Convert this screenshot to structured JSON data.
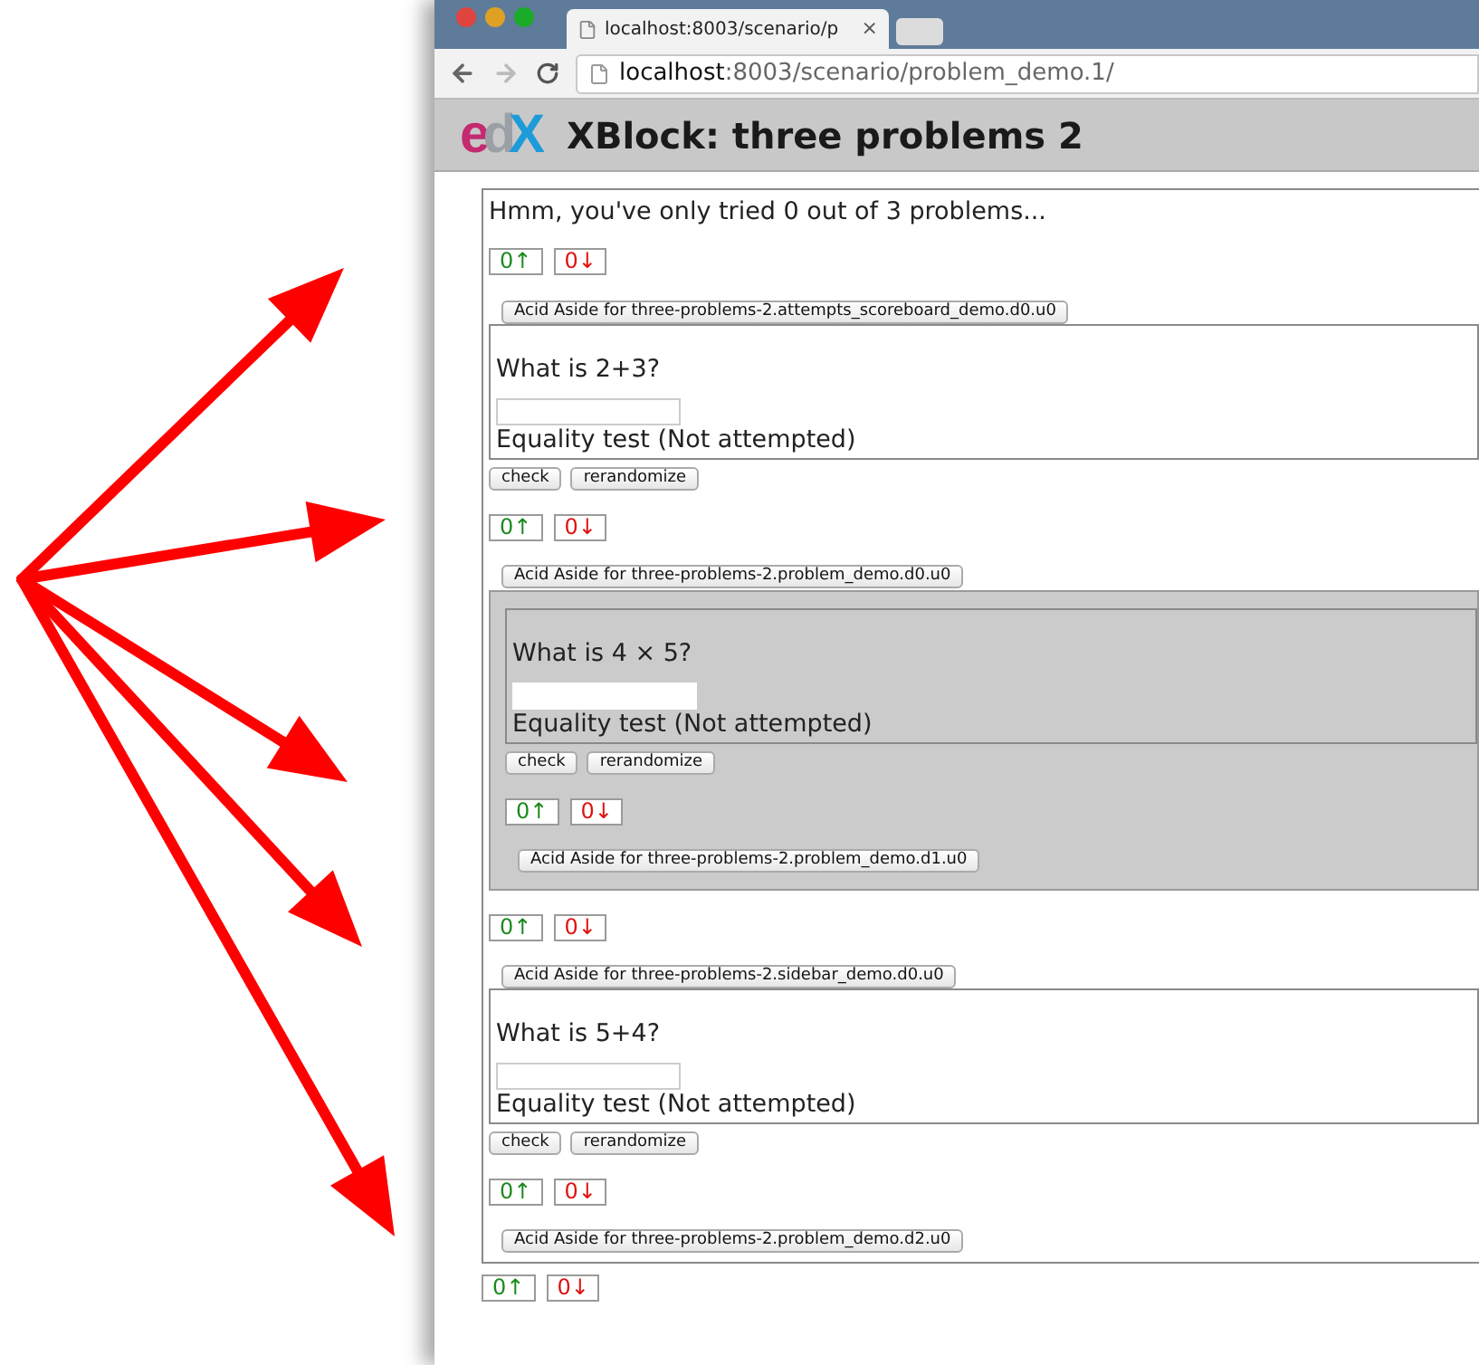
{
  "browser": {
    "tab": {
      "title": "localhost:8003/scenario/p",
      "close": "×"
    },
    "address": {
      "host": "localhost",
      "path": ":8003/scenario/problem_demo.1/"
    }
  },
  "header": {
    "logo": [
      {
        "text": "e",
        "color": "#c42a6f"
      },
      {
        "text": "d",
        "color": "#9aa0a6"
      },
      {
        "text": "X",
        "color": "#1c9ad9"
      }
    ],
    "title": "XBlock: three problems 2"
  },
  "scoreboard": {
    "message": "Hmm, you've only tried 0 out of 3 problems...",
    "votes": {
      "up": "0↑",
      "down": "0↓"
    },
    "aside": "Acid Aside for three-problems-2.attempts_scoreboard_demo.d0.u0"
  },
  "blocks": [
    {
      "kind": "problem",
      "question": "What is 2+3?",
      "status": "Equality test (Not attempted)",
      "buttons": [
        "check",
        "rerandomize"
      ],
      "votes": {
        "up": "0↑",
        "down": "0↓"
      },
      "aside": "Acid Aside for three-problems-2.problem_demo.d0.u0"
    },
    {
      "kind": "sidebar",
      "children": [
        {
          "kind": "problem",
          "question": "What is 4 × 5?",
          "status": "Equality test (Not attempted)",
          "buttons": [
            "check",
            "rerandomize"
          ],
          "votes": {
            "up": "0↑",
            "down": "0↓"
          },
          "aside": "Acid Aside for three-problems-2.problem_demo.d1.u0"
        }
      ],
      "votes": {
        "up": "0↑",
        "down": "0↓"
      },
      "aside": "Acid Aside for three-problems-2.sidebar_demo.d0.u0"
    },
    {
      "kind": "problem",
      "question": "What is 5+4?",
      "status": "Equality test (Not attempted)",
      "buttons": [
        "check",
        "rerandomize"
      ],
      "votes": {
        "up": "0↑",
        "down": "0↓"
      },
      "aside": "Acid Aside for three-problems-2.problem_demo.d2.u0"
    }
  ],
  "footer_votes": {
    "up": "0↑",
    "down": "0↓"
  }
}
